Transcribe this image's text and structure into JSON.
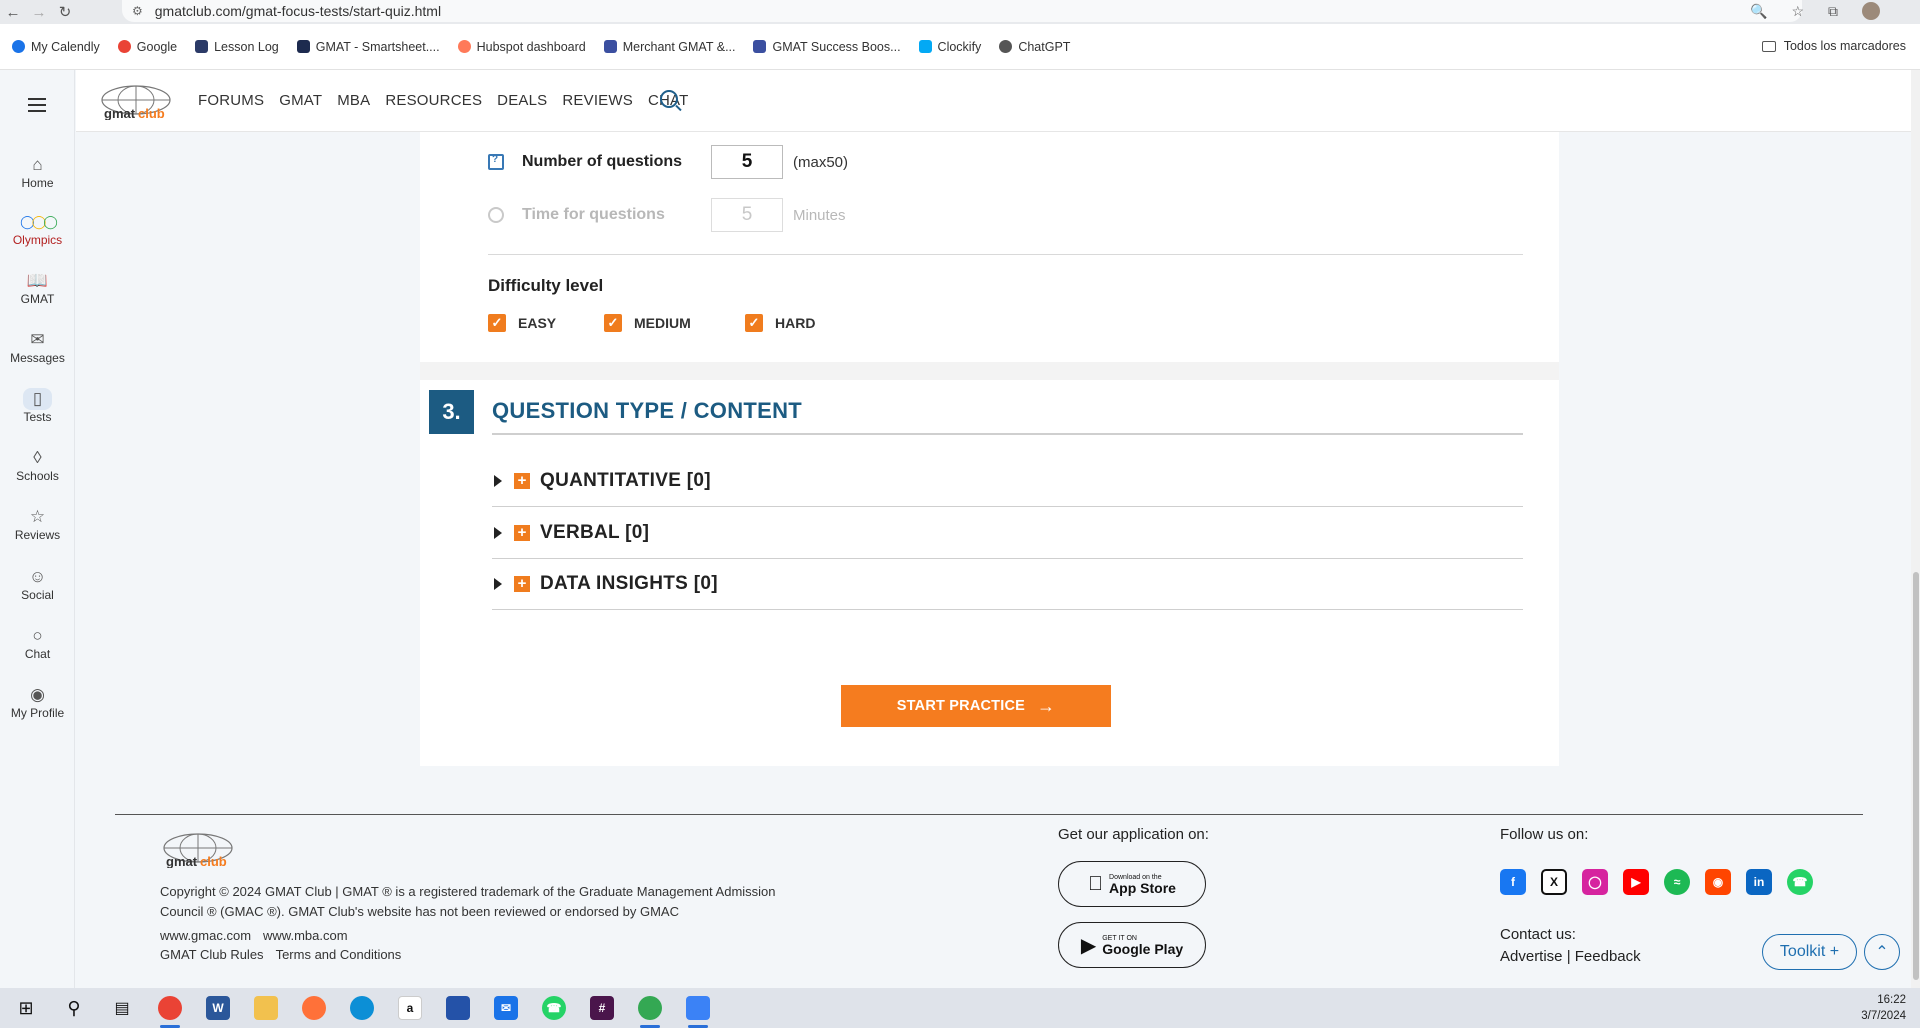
{
  "browser": {
    "url": "gmatclub.com/gmat-focus-tests/start-quiz.html",
    "bookmarks": [
      {
        "label": "My Calendly",
        "color": "#1a73e8"
      },
      {
        "label": "Google",
        "color": "#ea4335"
      },
      {
        "label": "Lesson Log",
        "color": "#2b3a67"
      },
      {
        "label": "GMAT - Smartsheet....",
        "color": "#1d2b4f"
      },
      {
        "label": "Hubspot dashboard",
        "color": "#ff7a59"
      },
      {
        "label": "Merchant GMAT &...",
        "color": "#3b4fa0"
      },
      {
        "label": "GMAT Success Boos...",
        "color": "#3b4fa0"
      },
      {
        "label": "Clockify",
        "color": "#03a9f4"
      },
      {
        "label": "ChatGPT",
        "color": "#555555"
      }
    ],
    "bookmarks_folder": "Todos los marcadores"
  },
  "rail": {
    "items": [
      {
        "label": "Home",
        "icon": "home-icon"
      },
      {
        "label": "Olympics",
        "icon": "olympic-rings-icon"
      },
      {
        "label": "GMAT",
        "icon": "book-icon"
      },
      {
        "label": "Messages",
        "icon": "mail-icon"
      },
      {
        "label": "Tests",
        "icon": "tests-icon"
      },
      {
        "label": "Schools",
        "icon": "school-icon"
      },
      {
        "label": "Reviews",
        "icon": "star-icon"
      },
      {
        "label": "Social",
        "icon": "people-icon"
      },
      {
        "label": "Chat",
        "icon": "chat-icon"
      },
      {
        "label": "My Profile",
        "icon": "profile-icon"
      }
    ]
  },
  "header": {
    "logo_text": "gmatclub",
    "menu": [
      "FORUMS",
      "GMAT",
      "MBA",
      "RESOURCES",
      "DEALS",
      "REVIEWS",
      "CHAT"
    ]
  },
  "settings": {
    "num_questions_label": "Number of questions",
    "num_questions_value": "5",
    "num_questions_suffix": "(max50)",
    "time_label": "Time for questions",
    "time_value": "5",
    "time_suffix": "Minutes",
    "difficulty_title": "Difficulty level",
    "difficulty": [
      {
        "label": "EASY",
        "checked": true
      },
      {
        "label": "MEDIUM",
        "checked": true
      },
      {
        "label": "HARD",
        "checked": true
      }
    ]
  },
  "section3": {
    "number": "3.",
    "title": "QUESTION TYPE / CONTENT",
    "categories": [
      "QUANTITATIVE [0]",
      "VERBAL [0]",
      "DATA INSIGHTS [0]"
    ]
  },
  "start_button": "START PRACTICE",
  "footer": {
    "logo_text": "gmatclub",
    "copyright": "Copyright © 2024 GMAT Club | GMAT ® is a registered trademark of the Graduate Management Admission Council ® (GMAC ®). GMAT Club's website has not been reviewed or endorsed by GMAC",
    "links_row1": [
      "www.gmac.com",
      "www.mba.com"
    ],
    "links_row2": [
      "GMAT Club Rules",
      "Terms and Conditions"
    ],
    "app_title": "Get our application on:",
    "app_store_small": "Download on the",
    "app_store_large": "App Store",
    "google_small": "GET IT ON",
    "google_large": "Google Play",
    "follow_title": "Follow us on:",
    "contact_title": "Contact us:",
    "contact_links": "Advertise | Feedback",
    "toolkit": "Toolkit +"
  },
  "taskbar": {
    "time": "16:22",
    "date": "3/7/2024"
  },
  "colors": {
    "accent_orange": "#f57c1f",
    "section_blue": "#1c5b82"
  }
}
